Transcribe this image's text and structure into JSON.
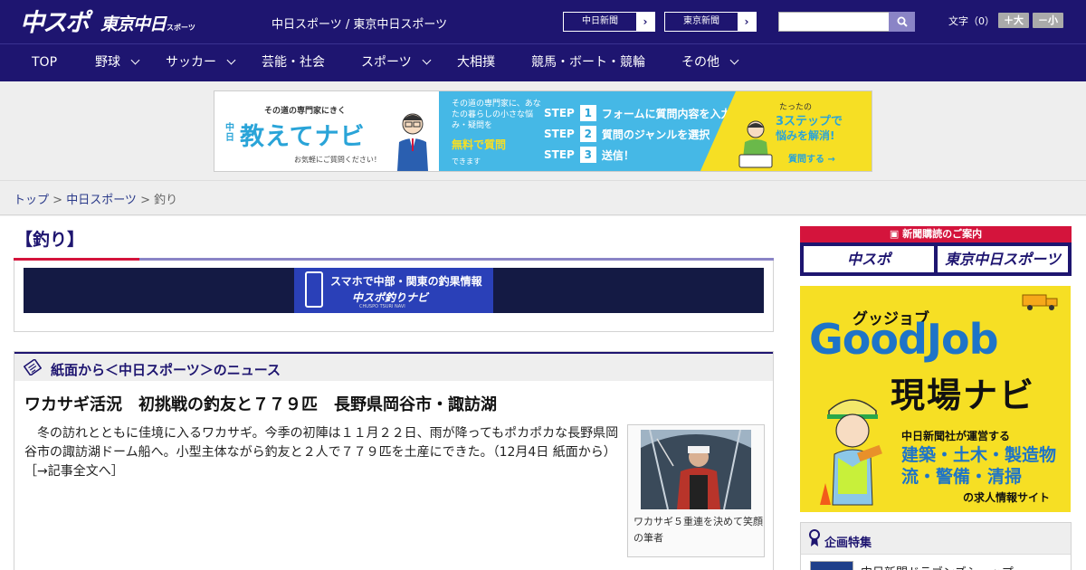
{
  "header": {
    "logo_main": "中スポ",
    "logo_tokyo": "東京中日",
    "logo_small": "スポーツ",
    "site_links": "中日スポーツ / 東京中日スポーツ",
    "chunichi_button": "中日新聞",
    "tokyo_button": "東京新聞",
    "search_placeholder": "",
    "fontsize_label": "文字（0）",
    "font_larger": "＋大",
    "font_smaller": "－小"
  },
  "nav": {
    "items": [
      "TOP",
      "野球",
      "サッカー",
      "芸能・社会",
      "スポーツ",
      "大相撲",
      "競馬・ボート・競輪",
      "その他"
    ]
  },
  "ad": {
    "lead": "その道の専門家にきく",
    "chu": "中日",
    "brand": "教えてナビ",
    "ask": "お気軽にご質問ください！",
    "desc": "その道の専門家に、あなたの暮らしの小さな悩み・疑問を",
    "free": "無料で質問",
    "can": "できます",
    "step1": "フォームに質問内容を入力",
    "step2": "質問のジャンルを選択",
    "step3": "送信！",
    "step_word": "STEP",
    "y1": "たったの",
    "y2": "3ステップで",
    "y3": "悩みを解消!",
    "y4": "質問する →"
  },
  "breadcrumb": {
    "top": "トップ",
    "sep": " > ",
    "chunichi": "中日スポーツ",
    "current": "釣り"
  },
  "category": {
    "title": "【釣り】"
  },
  "tsuri_banner": {
    "line1": "スマホで中部・関東の釣果情報",
    "line2": "中スポ釣りナビ",
    "line3": "CHUSPO TSURI NAVI"
  },
  "news": {
    "section_title": "紙面から＜中日スポーツ＞のニュース",
    "headline": "ワカサギ活況　初挑戦の釣友と７７９匹　長野県岡谷市・諏訪湖",
    "body": "　冬の訪れとともに佳境に入るワカサギ。今季の初陣は１１月２２日、雨が降ってもポカポカな長野県岡谷市の諏訪湖ドーム船へ。小型主体ながら釣友と２人で７７９匹を土産にできた。（12月4日 紙面から）",
    "more_link": "［→記事全文へ］",
    "photo_caption": "ワカサギ５重連を決めて笑顔の筆者"
  },
  "sidebar": {
    "sub_bar": "新聞購読のご案内",
    "sub_chuspo": "中スポ",
    "sub_tokyo": "東京中日スポーツ",
    "gj_kana": "グッジョブ",
    "gj_en": "GoodJob",
    "gj_gen": "現場ナビ",
    "gj_s1": "中日新聞社が運営する",
    "gj_s2": "建築・土木・製造物流・警備・清掃",
    "gj_s3": "の求人情報サイト",
    "kikaku_title": "企画特集",
    "kikaku_item": "中日新聞ドラゴンズショップ"
  },
  "colors": {
    "brand_navy": "#1e1570",
    "accent_red": "#d4143c",
    "accent_lavender": "#8a84c6"
  }
}
